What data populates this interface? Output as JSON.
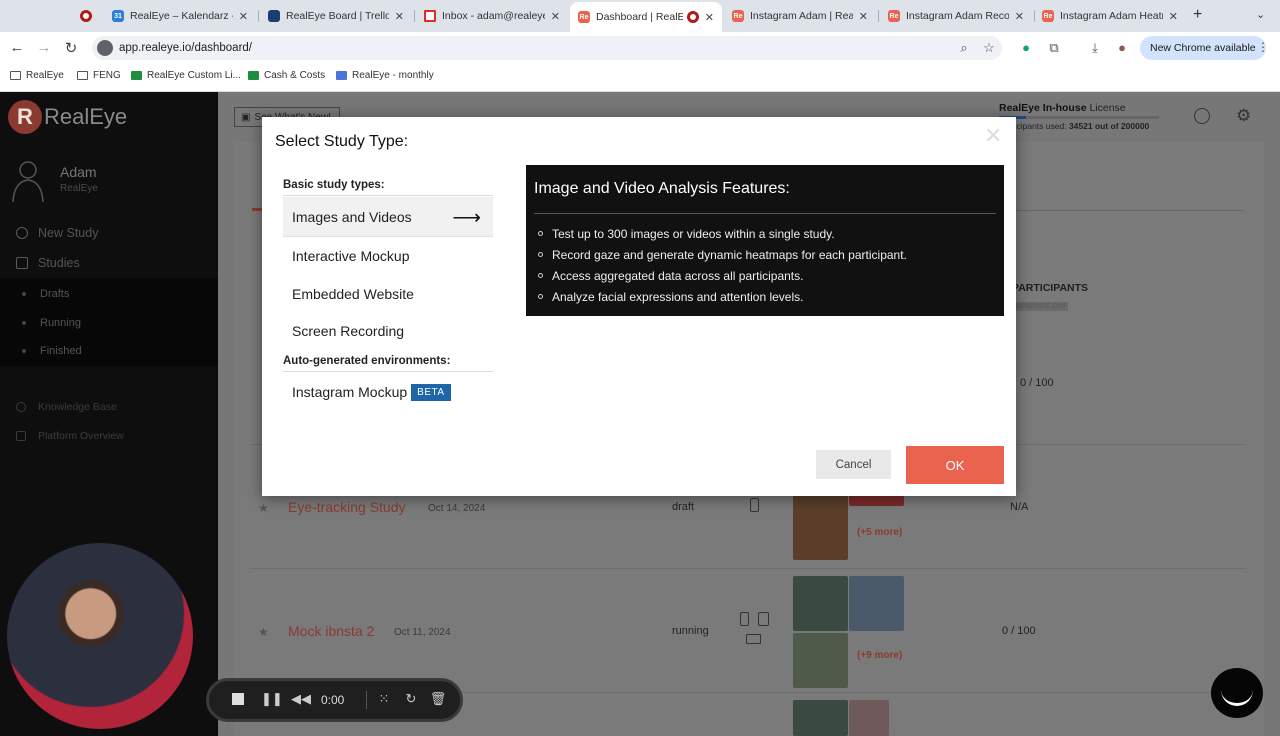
{
  "browser": {
    "tabs": [
      {
        "title": "",
        "favicon_color": "#b01c1c"
      },
      {
        "title": "RealEye – Kalendarz - T",
        "favicon_color": "#2f7fd6"
      },
      {
        "title": "RealEye Board | Trello",
        "favicon_color": "#1e3b70"
      },
      {
        "title": "Inbox - adam@realeye.i",
        "favicon_color": "#d93025"
      },
      {
        "title": "Dashboard | RealEye",
        "favicon_color": "#e9634f"
      },
      {
        "title": "Instagram Adam | RealE",
        "favicon_color": "#e9634f"
      },
      {
        "title": "Instagram Adam Record",
        "favicon_color": "#e9634f"
      },
      {
        "title": "Instagram Adam Heatm",
        "favicon_color": "#e9634f"
      }
    ],
    "url": "app.realeye.io/dashboard/",
    "update_label": "New Chrome available",
    "bookmarks": [
      "RealEye",
      "FENG",
      "RealEye Custom Li...",
      "Cash & Costs",
      "RealEye - monthly"
    ]
  },
  "sidebar": {
    "logo_text": "RealEye",
    "user_name": "Adam",
    "user_org": "RealEye",
    "nav": [
      "New Study",
      "Studies"
    ],
    "sub_nav": [
      "Drafts",
      "Running",
      "Finished"
    ],
    "footer": [
      "Knowledge Base",
      "Platform Overview"
    ]
  },
  "dashboard": {
    "whats_new": "See What's New!",
    "license_name": "RealEye In-house",
    "license_word": "License",
    "license_used_label": "Participants used:",
    "license_used_value": "34521 out of 200000",
    "license_fraction": 0.17,
    "participants_header": "PARTICIPANTS",
    "participants_sub": "GENERATE CSV",
    "row1_participants": "0 / 100",
    "rows": [
      {
        "name": "Eye-tracking Study",
        "date": "Oct 14, 2024",
        "status": "draft",
        "participants": "N/A",
        "more": "(+5 more)"
      },
      {
        "name": "Mock ibnsta 2",
        "date": "Oct 11, 2024",
        "status": "running",
        "participants": "0 / 100",
        "more": "(+9 more)"
      }
    ]
  },
  "modal": {
    "title": "Select Study Type:",
    "basic_label": "Basic study types:",
    "options": [
      "Images and Videos",
      "Interactive Mockup",
      "Embedded Website",
      "Screen Recording"
    ],
    "auto_label": "Auto-generated environments:",
    "auto_options": [
      "Instagram Mockup"
    ],
    "beta_label": "BETA",
    "features_title": "Image and Video Analysis Features:",
    "features": [
      "Test up to 300 images or videos within a single study.",
      "Record gaze and generate dynamic heatmaps for each participant.",
      "Access aggregated data across all participants.",
      "Analyze facial expressions and attention levels."
    ],
    "cancel_label": "Cancel",
    "ok_label": "OK"
  },
  "recorder": {
    "time": "0:00"
  },
  "colors": {
    "accent": "#e9634f",
    "beta": "#1e66a8",
    "brand_dark": "#8a3a30"
  }
}
